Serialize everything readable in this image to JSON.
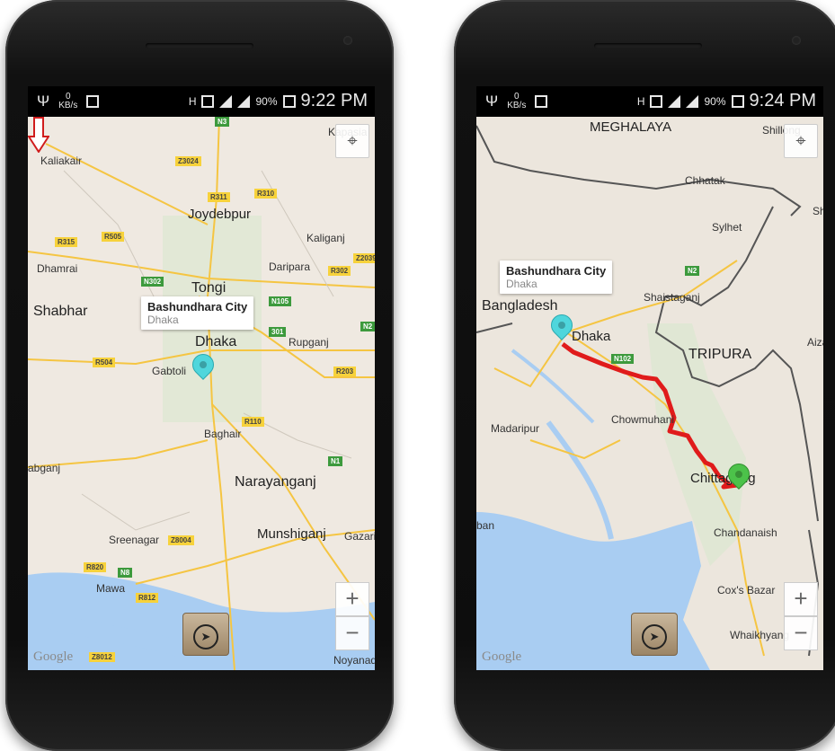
{
  "left": {
    "status": {
      "kb": "0",
      "kb_unit": "KB/s",
      "battery": "90%",
      "time": "9:22 PM"
    },
    "map_labels": [
      "Kapasia",
      "Kaliakair",
      "Joydebpur",
      "Kaliganj",
      "Dhamrai",
      "Daripara",
      "Tongi",
      "Shabhar",
      "Rupganj",
      "Gabtoli",
      "Baghair",
      "Narayanganj",
      "Munshiganj",
      "Gazari",
      "Sreenagar",
      "Mawa",
      "Noyanad",
      "abganj",
      "Dhaka"
    ],
    "road_shields": [
      "N3",
      "Z3024",
      "R311",
      "R310",
      "R315",
      "R505",
      "Z2039",
      "R302",
      "N302",
      "N105",
      "301",
      "N2",
      "R504",
      "R203",
      "R110",
      "N1",
      "Z8004",
      "R820",
      "N8",
      "R812",
      "Z8012"
    ],
    "callout": {
      "title": "Bashundhara City",
      "subtitle": "Dhaka"
    },
    "google": "Google",
    "zoom_in": "+",
    "zoom_out": "−",
    "nav_icon": "navigation-arrow-icon",
    "locate_icon": "my-location-icon"
  },
  "right": {
    "status": {
      "kb": "0",
      "kb_unit": "KB/s",
      "battery": "90%",
      "time": "9:24 PM"
    },
    "map_labels": [
      "MEGHALAYA",
      "Shillong",
      "Chhatak",
      "Sylhet",
      "Sh",
      "Shaistaganj",
      "Bangladesh",
      "Dhaka",
      "TRIPURA",
      "Aiza",
      "Madaripur",
      "Chowmuhani",
      "Chittagong",
      "ban",
      "Chandanaish",
      "Cox's Bazar",
      "Whaikhyang"
    ],
    "road_shields": [
      "N2",
      "N102"
    ],
    "callout": {
      "title": "Bashundhara City",
      "subtitle": "Dhaka"
    },
    "google": "Google",
    "zoom_in": "+",
    "zoom_out": "−",
    "nav_icon": "navigation-arrow-icon",
    "locate_icon": "my-location-icon",
    "route_color": "#e01b1b"
  }
}
